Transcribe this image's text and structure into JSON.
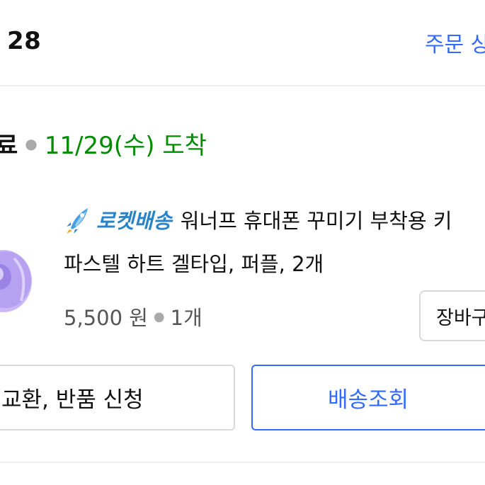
{
  "header": {
    "order_date": "28",
    "order_detail_link": "주문 상"
  },
  "status": {
    "prefix": "료",
    "arrival": "11/29(수) 도착"
  },
  "product": {
    "badge_label": "로켓배송",
    "name_line1": "워너프 휴대폰 꾸미기 부착용 키",
    "name_line2": "파스텔 하트 겔타입, 퍼플, 2개",
    "price": "5,500 원",
    "quantity": "1개",
    "cart_button_label": "장바구"
  },
  "actions": {
    "exchange_return_label": "교환, 반품 신청",
    "tracking_label": "배송조회"
  },
  "colors": {
    "accent_blue": "#346aff",
    "arrival_green": "#008c00",
    "rocket_blue": "#2a84c8",
    "thumb_purple": "#b7a2f2"
  },
  "icons": {
    "badge_icon": "rocket-icon",
    "thumbnail": "purple-heart-grip-image"
  }
}
